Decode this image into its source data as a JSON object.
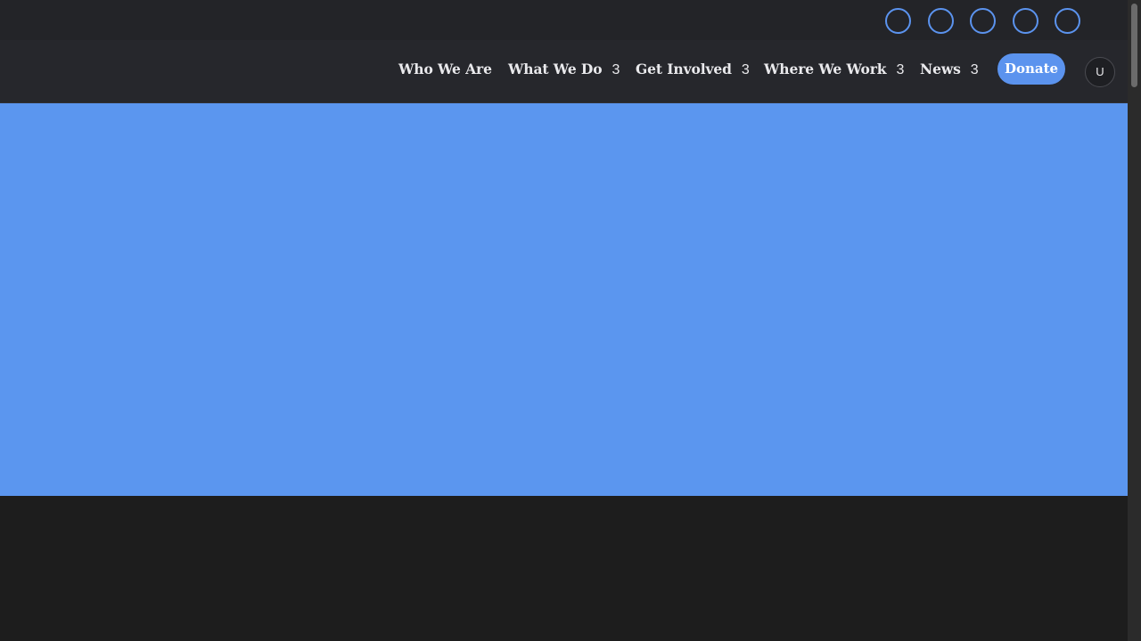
{
  "topbar": {
    "social_icons": [
      "social-icon-1",
      "social-icon-2",
      "social-icon-3",
      "social-icon-4",
      "social-icon-5"
    ],
    "icon_color": "#5b93ee"
  },
  "nav": {
    "items": [
      {
        "label": "Who We Are",
        "count": ""
      },
      {
        "label": "What We Do",
        "count": "3"
      },
      {
        "label": "Get Involved",
        "count": "3"
      },
      {
        "label": "Where We Work",
        "count": "3"
      },
      {
        "label": "News",
        "count": "3"
      }
    ],
    "donate_label": "Donate",
    "avatar_initial": "U"
  },
  "colors": {
    "accent": "#5b93ee",
    "hero_background": "#5b96ef",
    "header_background": "#26272c",
    "page_background": "#1d1d1d"
  }
}
